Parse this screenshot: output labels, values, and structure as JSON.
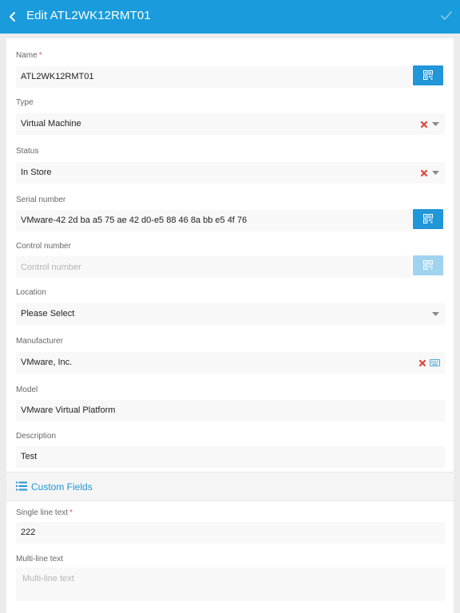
{
  "header": {
    "title": "Edit ATL2WK12RMT01"
  },
  "fields": {
    "name": {
      "label": "Name",
      "required": "*",
      "value": "ATL2WK12RMT01"
    },
    "type": {
      "label": "Type",
      "value": "Virtual Machine"
    },
    "status": {
      "label": "Status",
      "value": "In Store"
    },
    "serial": {
      "label": "Serial number",
      "value": "VMware-42 2d ba a5 75 ae 42 d0-e5 88 46 8a bb e5 4f 76"
    },
    "control": {
      "label": "Control number",
      "placeholder": "Control number"
    },
    "location": {
      "label": "Location",
      "value": "Please Select"
    },
    "manufacturer": {
      "label": "Manufacturer",
      "value": "VMware, Inc."
    },
    "model": {
      "label": "Model",
      "value": "VMware Virtual Platform"
    },
    "description": {
      "label": "Description",
      "value": "Test"
    }
  },
  "custom_fields": {
    "title": "Custom Fields",
    "single_line": {
      "label": "Single line text",
      "required": "*",
      "value": "222"
    },
    "multi_line": {
      "label": "Multi-line text",
      "placeholder": "Multi-line text"
    }
  },
  "colors": {
    "accent": "#1a9bdc",
    "button": "#2196d8",
    "button_disabled": "#9fd3ef",
    "clear": "#e0463b",
    "required": "#e05a4e"
  },
  "icons": {
    "back": "chevron-left-icon",
    "save": "checkmark-icon",
    "scan": "qr-code-icon",
    "clear": "close-icon",
    "dropdown": "caret-down-icon",
    "keyboard": "keyboard-icon",
    "section": "list-icon"
  }
}
